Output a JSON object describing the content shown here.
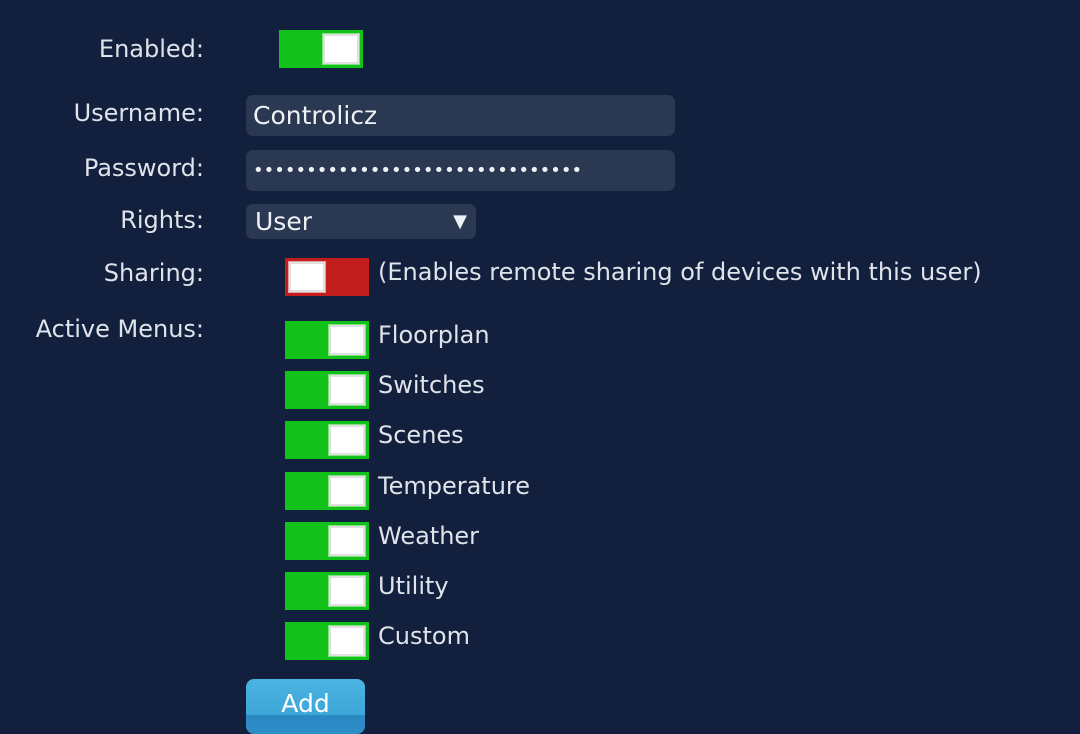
{
  "form": {
    "enabled": {
      "label": "Enabled:",
      "value": true
    },
    "username": {
      "label": "Username:",
      "value": "Controlicz"
    },
    "password": {
      "label": "Password:",
      "value": "•••••••••••••••••••••••••••••••"
    },
    "rights": {
      "label": "Rights:",
      "value": "User",
      "arrow": "▼"
    },
    "sharing": {
      "label": "Sharing:",
      "value": false,
      "description": "(Enables remote sharing of devices with this user)"
    },
    "active_menus": {
      "label": "Active Menus:",
      "items": [
        {
          "label": "Floorplan",
          "value": true
        },
        {
          "label": "Switches",
          "value": true
        },
        {
          "label": "Scenes",
          "value": true
        },
        {
          "label": "Temperature",
          "value": true
        },
        {
          "label": "Weather",
          "value": true
        },
        {
          "label": "Utility",
          "value": true
        },
        {
          "label": "Custom",
          "value": true
        }
      ]
    },
    "add_button": "Add"
  },
  "colors": {
    "background": "#121f3d",
    "toggle_on": "#12c11a",
    "toggle_off": "#c21e1e",
    "button": "#3da6d8"
  }
}
